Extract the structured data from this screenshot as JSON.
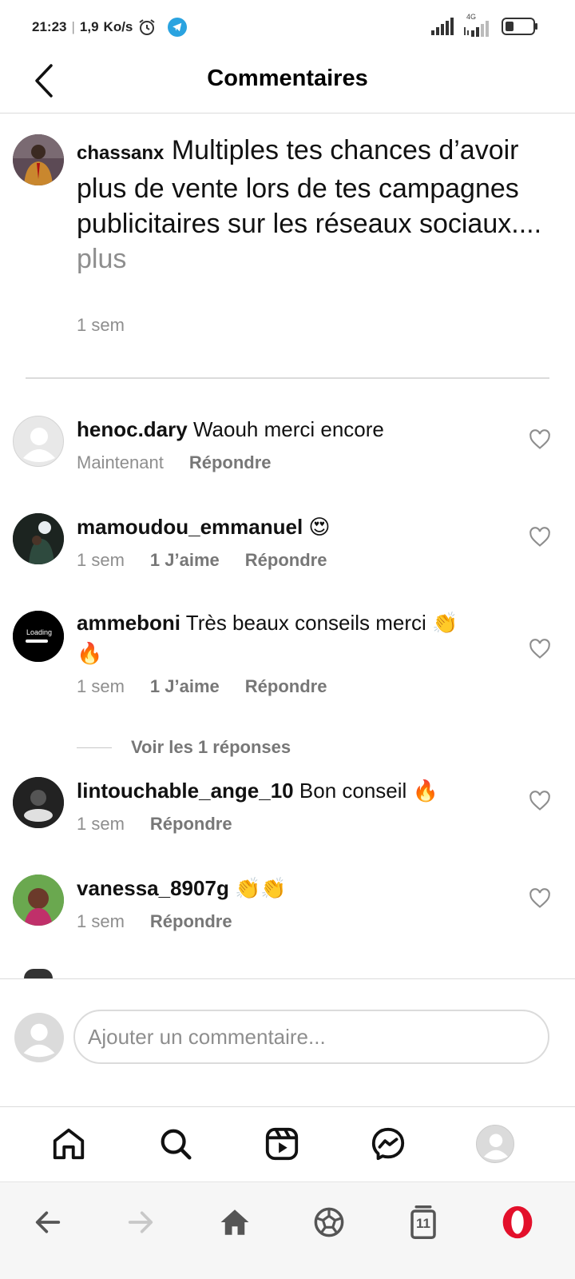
{
  "status_bar": {
    "time": "21:23",
    "speed": "1,9",
    "speed_unit": "Ko/s",
    "network": "4G"
  },
  "header": {
    "title": "Commentaires"
  },
  "caption": {
    "username": "chassanx",
    "text": "Multiples tes chances d’avoir plus de vente lors de tes campagnes publicitaires sur les réseaux sociaux....",
    "more_label": "plus",
    "time": "1 sem"
  },
  "comments": [
    {
      "username": "henoc.dary",
      "text": "Waouh merci encore",
      "time": "Maintenant",
      "likes": "",
      "reply_label": "Répondre"
    },
    {
      "username": "mamoudou_emmanuel",
      "text": "😍",
      "time": "1 sem",
      "likes": "1 J’aime",
      "reply_label": "Répondre"
    },
    {
      "username": "ammeboni",
      "text": "Très beaux conseils merci 👏 🔥",
      "time": "1 sem",
      "likes": "1 J’aime",
      "reply_label": "Répondre",
      "avatar_text": "Loading"
    },
    {
      "username": "lintouchable_ange_10",
      "text": "Bon conseil 🔥",
      "time": "1 sem",
      "likes": "",
      "reply_label": "Répondre"
    },
    {
      "username": "vanessa_8907g",
      "text": "👏👏",
      "time": "1 sem",
      "likes": "",
      "reply_label": "Répondre"
    }
  ],
  "view_replies_label": "Voir les 1 réponses",
  "add_comment": {
    "placeholder": "Ajouter un commentaire..."
  },
  "browser_nav": {
    "tabs_count": "11"
  },
  "colors": {
    "telegram": "#2aa3e0",
    "opera_red": "#e3102b",
    "secondary_text": "#8e8e8e",
    "divider": "#dbdbdb"
  }
}
